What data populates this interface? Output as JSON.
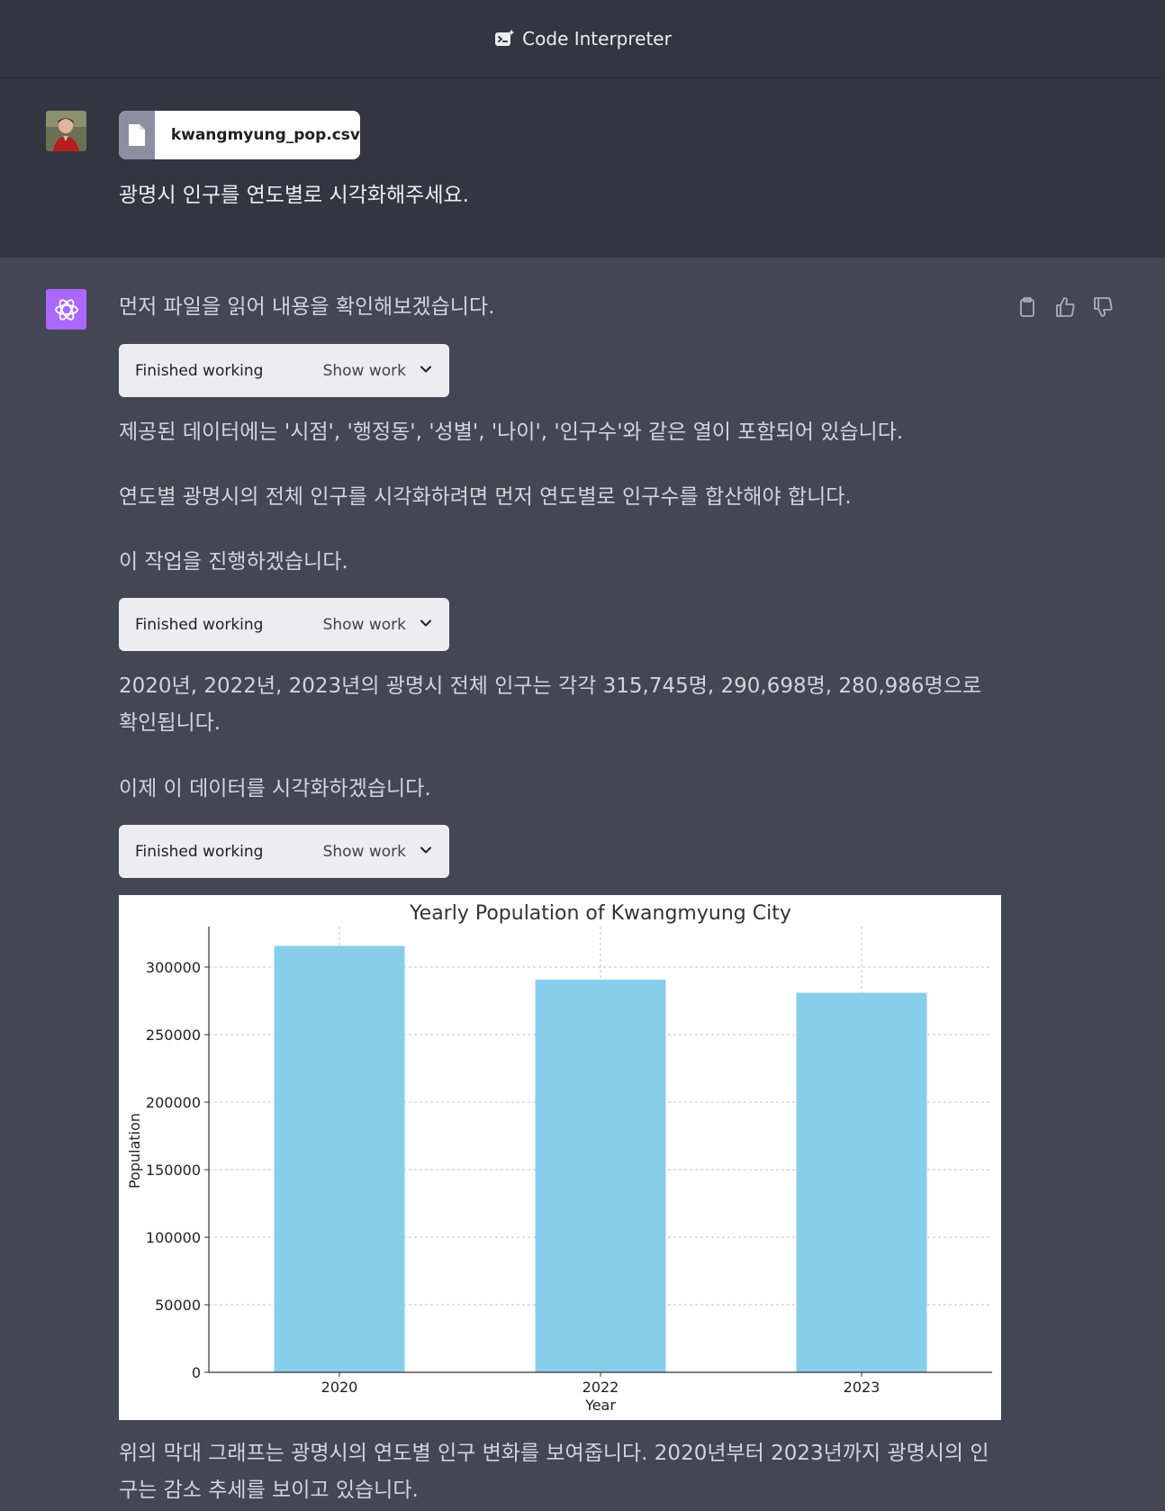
{
  "header": {
    "title": "Code Interpreter"
  },
  "user_message": {
    "file_name": "kwangmyung_pop.csv",
    "text": "광명시 인구를 연도별로 시각화해주세요."
  },
  "assistant_message": {
    "p1": "먼저 파일을 읽어 내용을 확인해보겠습니다.",
    "work1": {
      "status": "Finished working",
      "toggle": "Show work"
    },
    "p2": "제공된 데이터에는 '시점', '행정동', '성별', '나이', '인구수'와 같은 열이 포함되어 있습니다.",
    "p3": "연도별 광명시의 전체 인구를 시각화하려면 먼저 연도별로 인구수를 합산해야 합니다.",
    "p4": "이 작업을 진행하겠습니다.",
    "work2": {
      "status": "Finished working",
      "toggle": "Show work"
    },
    "p5": "2020년, 2022년, 2023년의 광명시 전체 인구는 각각 315,745명, 290,698명, 280,986명으로 확인됩니다.",
    "p6": "이제 이 데이터를 시각화하겠습니다.",
    "work3": {
      "status": "Finished working",
      "toggle": "Show work"
    },
    "p7": "위의 막대 그래프는 광명시의 연도별 인구 변화를 보여줍니다. 2020년부터 2023년까지 광명시의 인구는 감소 추세를 보이고 있습니다."
  },
  "colors": {
    "bar": "#87ceeb",
    "avatar_gpt": "#ab68ff",
    "bg_user": "#343541",
    "bg_assistant": "#444654"
  },
  "chart_data": {
    "type": "bar",
    "title": "Yearly Population of Kwangmyung City",
    "xlabel": "Year",
    "ylabel": "Population",
    "categories": [
      "2020",
      "2022",
      "2023"
    ],
    "values": [
      315745,
      290698,
      280986
    ],
    "yticks": [
      0,
      50000,
      100000,
      150000,
      200000,
      250000,
      300000
    ],
    "ylim": [
      0,
      330000
    ],
    "grid": true
  }
}
